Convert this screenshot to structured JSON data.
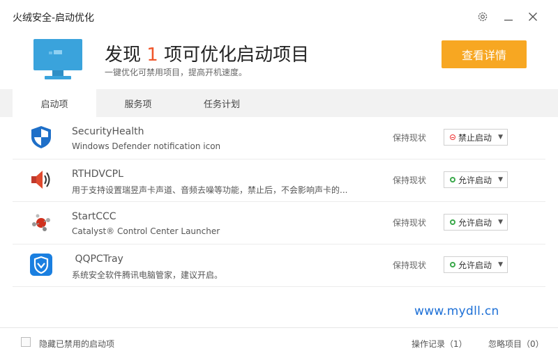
{
  "window": {
    "title": "火绒安全-启动优化",
    "settings_icon": "gear-icon",
    "minimize_icon": "minimize-icon",
    "close_icon": "close-icon"
  },
  "header": {
    "headline_prefix": "发现 ",
    "count": "1",
    "headline_suffix": " 项可优化启动项目",
    "subtitle": "一键优化可禁用项目，提高开机速度。",
    "detail_button": "查看详情",
    "accent_color": "#f7a722",
    "count_color": "#f0562a"
  },
  "tabs": [
    {
      "label": "启动项",
      "active": true
    },
    {
      "label": "服务项",
      "active": false
    },
    {
      "label": "任务计划",
      "active": false
    }
  ],
  "items": [
    {
      "name": "SecurityHealth",
      "desc": "Windows Defender notification icon",
      "status": "保持现状",
      "action": "禁止启动",
      "action_type": "deny",
      "icon": "defender-shield-icon"
    },
    {
      "name": "RTHDVCPL",
      "desc": "用于支持设置瑞昱声卡声道、音频去噪等功能，禁止后，不会影响声卡的...",
      "status": "保持现状",
      "action": "允许启动",
      "action_type": "allow",
      "icon": "speaker-icon"
    },
    {
      "name": "StartCCC",
      "desc": "Catalyst® Control Center Launcher",
      "status": "保持现状",
      "action": "允许启动",
      "action_type": "allow",
      "icon": "catalyst-icon"
    },
    {
      "name": " QQPCTray",
      "desc": "系统安全软件腾讯电脑管家，建议开启。",
      "status": "保持现状",
      "action": "允许启动",
      "action_type": "allow",
      "icon": "qq-pc-manager-icon"
    }
  ],
  "watermark": "www.mydll.cn",
  "footer": {
    "hide_disabled_label": "隐藏已禁用的启动项",
    "operation_log": "操作记录（1）",
    "ignored_items": "忽略项目（0）"
  }
}
